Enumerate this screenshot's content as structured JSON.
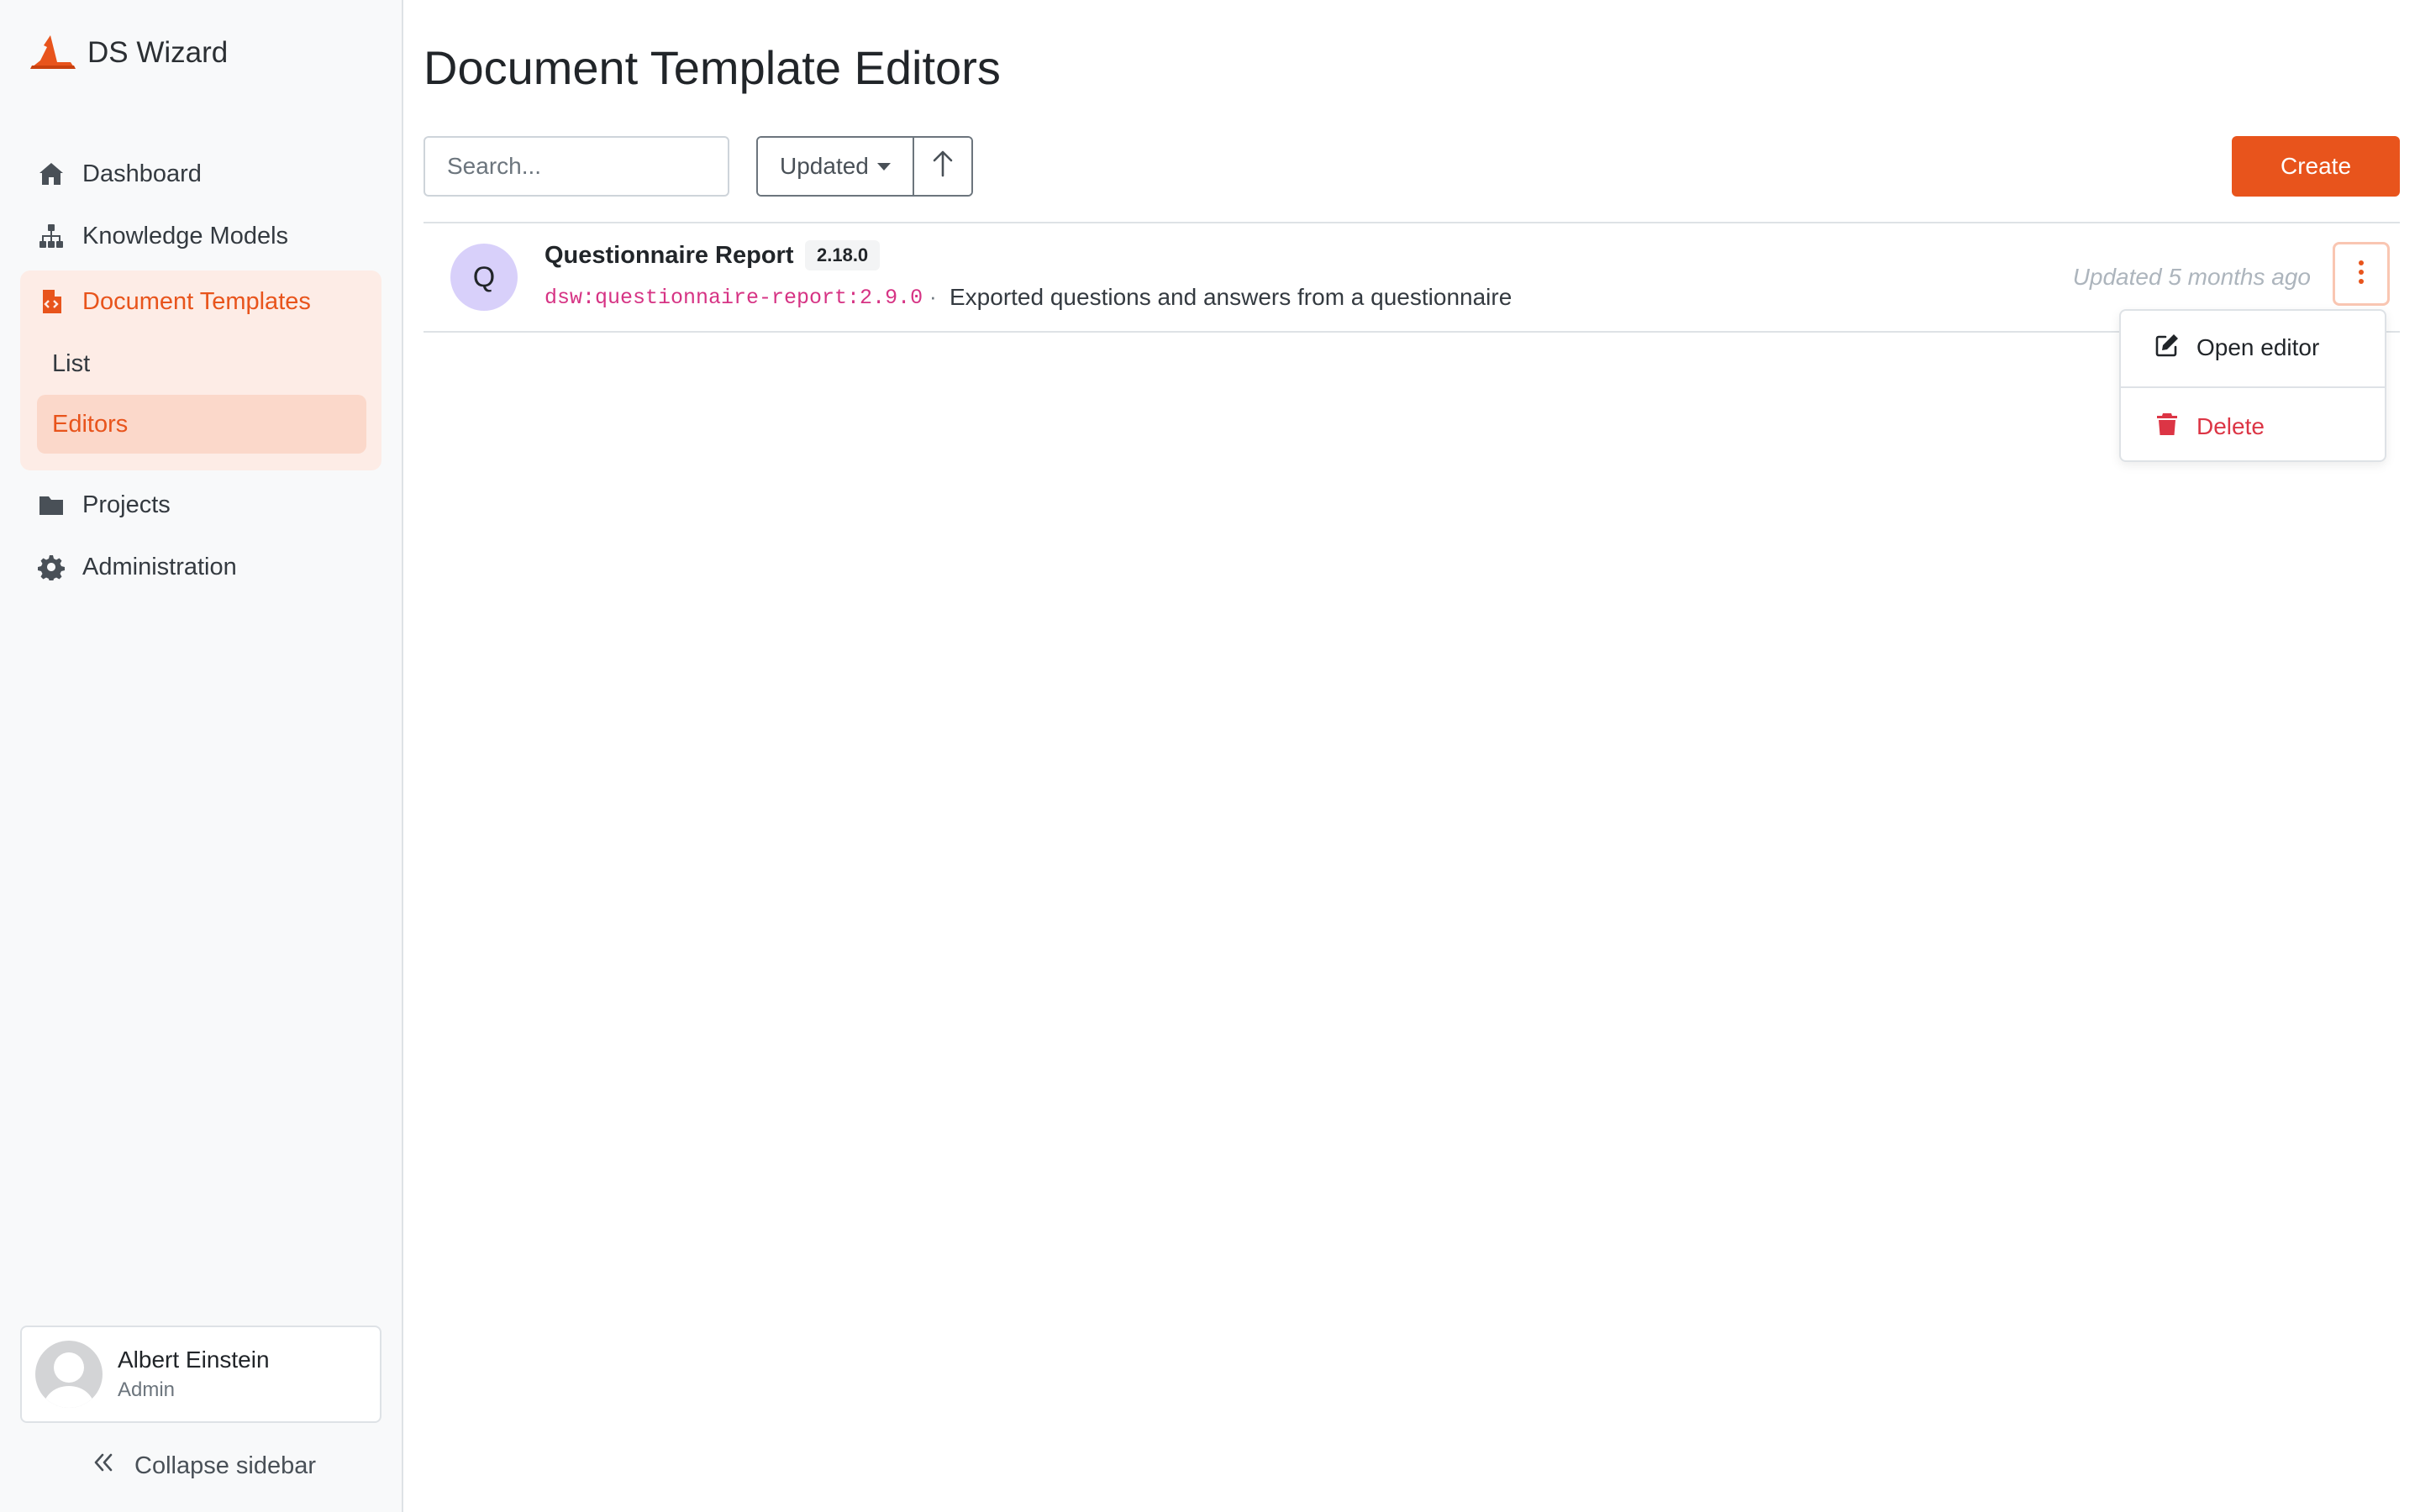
{
  "app": {
    "name": "DS Wizard",
    "brand_color": "#e8541c"
  },
  "sidebar": {
    "nav": [
      {
        "label": "Dashboard",
        "icon": "home-icon"
      },
      {
        "label": "Knowledge Models",
        "icon": "sitemap-icon"
      },
      {
        "label": "Document Templates",
        "icon": "file-code-icon",
        "active": true,
        "children": [
          {
            "label": "List"
          },
          {
            "label": "Editors",
            "active": true
          }
        ]
      },
      {
        "label": "Projects",
        "icon": "folder-icon"
      },
      {
        "label": "Administration",
        "icon": "gear-icon"
      }
    ],
    "user": {
      "name": "Albert Einstein",
      "role": "Admin"
    },
    "collapse_label": "Collapse sidebar"
  },
  "main": {
    "title": "Document Template Editors",
    "search": {
      "placeholder": "Search...",
      "value": ""
    },
    "sort": {
      "label": "Updated",
      "direction": "ascending"
    },
    "create_label": "Create",
    "items": [
      {
        "initial": "Q",
        "title": "Questionnaire Report",
        "version": "2.18.0",
        "id": "dsw:questionnaire-report:2.9.0",
        "separator": "·",
        "description": "Exported questions and answers from a questionnaire",
        "updated": "Updated 5 months ago"
      }
    ],
    "dropdown": {
      "open_editor": "Open editor",
      "delete": "Delete"
    }
  }
}
